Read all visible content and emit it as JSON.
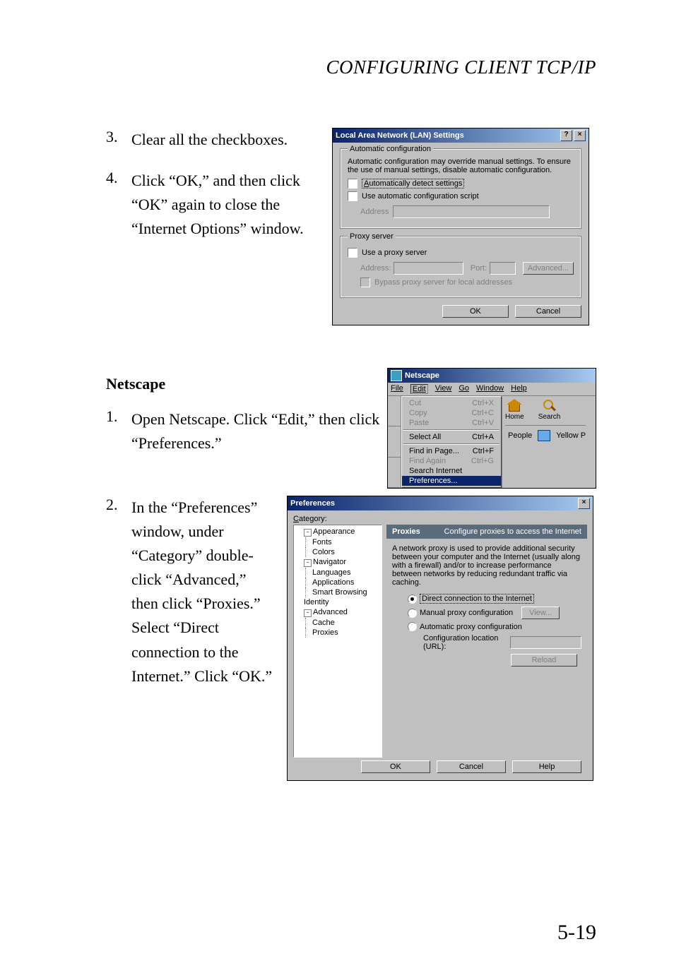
{
  "page": {
    "header": "CONFIGURING CLIENT TCP/IP",
    "page_number": "5-19"
  },
  "steps_top": {
    "s3_num": "3.",
    "s3_text": "Clear all the checkboxes.",
    "s4_num": "4.",
    "s4_text": "Click “OK,” and then click “OK” again to close the “Internet Options” window."
  },
  "netscape_heading": "Netscape",
  "steps_netscape": {
    "s1_num": "1.",
    "s1_text": "Open Netscape. Click “Edit,” then click “Preferences.”",
    "s2_num": "2.",
    "s2_text": "In the “Preferences” window, under “Category” double-click “Advanced,” then click “Proxies.” Select “Direct connection to the Internet.” Click “OK.”"
  },
  "lan": {
    "title": "Local Area Network (LAN) Settings",
    "help_btn": "?",
    "close_btn": "×",
    "auto_group": "Automatic configuration",
    "auto_desc": "Automatic configuration may override manual settings.  To ensure the use of manual settings, disable automatic configuration.",
    "auto_detect": "Automatically detect settings",
    "use_script": "Use automatic configuration script",
    "address_label": "Address",
    "proxy_group": "Proxy server",
    "use_proxy": "Use a proxy server",
    "addr2": "Address:",
    "port": "Port:",
    "advanced": "Advanced...",
    "bypass": "Bypass proxy server for local addresses",
    "ok": "OK",
    "cancel": "Cancel"
  },
  "ns_menu": {
    "title": "Netscape",
    "menubar": {
      "file": "File",
      "edit": "Edit",
      "view": "View",
      "go": "Go",
      "window": "Window",
      "help": "Help"
    },
    "items": {
      "cut": {
        "label": "Cut",
        "accel": "Ctrl+X"
      },
      "copy": {
        "label": "Copy",
        "accel": "Ctrl+C"
      },
      "paste": {
        "label": "Paste",
        "accel": "Ctrl+V"
      },
      "selectall": {
        "label": "Select All",
        "accel": "Ctrl+A"
      },
      "find": {
        "label": "Find in Page...",
        "accel": "Ctrl+F"
      },
      "findagain": {
        "label": "Find Again",
        "accel": "Ctrl+G"
      },
      "searchinet": {
        "label": "Search Internet",
        "accel": ""
      },
      "prefs": {
        "label": "Preferences...",
        "accel": ""
      }
    },
    "toolbar": {
      "home": "Home",
      "search": "Search",
      "people": "People",
      "yellow": "Yellow P"
    }
  },
  "pref": {
    "title": "Preferences",
    "close": "×",
    "category_label_pre": "C",
    "category_label_rest": "ategory:",
    "tree": {
      "appearance": "Appearance",
      "fonts": "Fonts",
      "colors": "Colors",
      "navigator": "Navigator",
      "languages": "Languages",
      "applications": "Applications",
      "smart": "Smart Browsing",
      "identity": "Identity",
      "advanced": "Advanced",
      "cache": "Cache",
      "proxies": "Proxies"
    },
    "header_title": "Proxies",
    "header_desc": "Configure proxies to access the Internet",
    "body_desc": "A network proxy is used to provide additional security between your computer and the Internet (usually along with a firewall) and/or to increase performance between networks by reducing redundant traffic via caching.",
    "radio_direct": "Direct connection to the Internet",
    "radio_manual": "Manual proxy configuration",
    "view_btn": "View...",
    "radio_auto": "Automatic proxy configuration",
    "config_url": "Configuration location (URL):",
    "reload": "Reload",
    "ok": "OK",
    "cancel": "Cancel",
    "help": "Help"
  }
}
